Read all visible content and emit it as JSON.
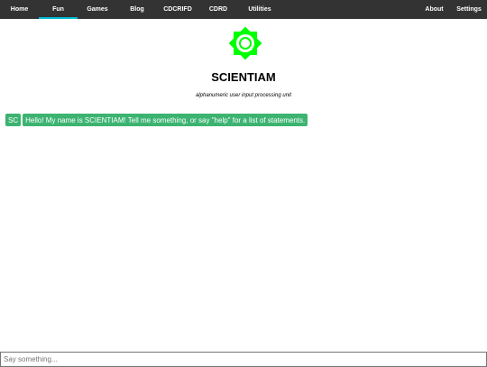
{
  "nav": {
    "left": [
      {
        "label": "Home",
        "active": false
      },
      {
        "label": "Fun",
        "active": true
      },
      {
        "label": "Games",
        "active": false
      },
      {
        "label": "Blog",
        "active": false
      },
      {
        "label": "CDCRIFD",
        "active": false
      },
      {
        "label": "CDRD",
        "active": false
      },
      {
        "label": "Utilities",
        "active": false
      }
    ],
    "right": [
      {
        "label": "About"
      },
      {
        "label": "Settings"
      }
    ]
  },
  "header": {
    "logo_icon": "green-octagram-ring-icon",
    "title": "SCIENTIAM",
    "subtitle": "alphanumeric user input processing unit"
  },
  "chat": {
    "messages": [
      {
        "avatar": "SC",
        "text": "Hello! My name is SCIENTIAM! Tell me something, or say \"help\" for a list of statements."
      }
    ]
  },
  "input": {
    "value": "",
    "placeholder": "Say something..."
  },
  "colors": {
    "navbar": "#333333",
    "active_indicator": "#00bcd4",
    "bubble": "#3cb371",
    "logo": "#00ff00"
  }
}
